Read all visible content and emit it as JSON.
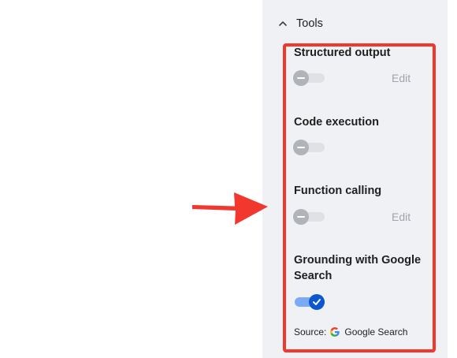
{
  "section": {
    "title": "Tools",
    "icon": "chevron-up-icon"
  },
  "tools": [
    {
      "label": "Structured output",
      "enabled": false,
      "edit_label": "Edit"
    },
    {
      "label": "Code execution",
      "enabled": false
    },
    {
      "label": "Function calling",
      "enabled": false,
      "edit_label": "Edit"
    },
    {
      "label_line1": "Grounding with Google",
      "label_line2": "Search",
      "enabled": true
    }
  ],
  "source": {
    "prefix": "Source:",
    "name": "Google Search",
    "icon": "google-g-icon"
  },
  "annotations": {
    "highlight_color": "#f2382e",
    "arrow_color": "#f2382e"
  },
  "colors": {
    "toggle_on": "#0b57d0",
    "toggle_off_knob": "#b0b3b8",
    "panel_bg": "#f0f1f4"
  }
}
